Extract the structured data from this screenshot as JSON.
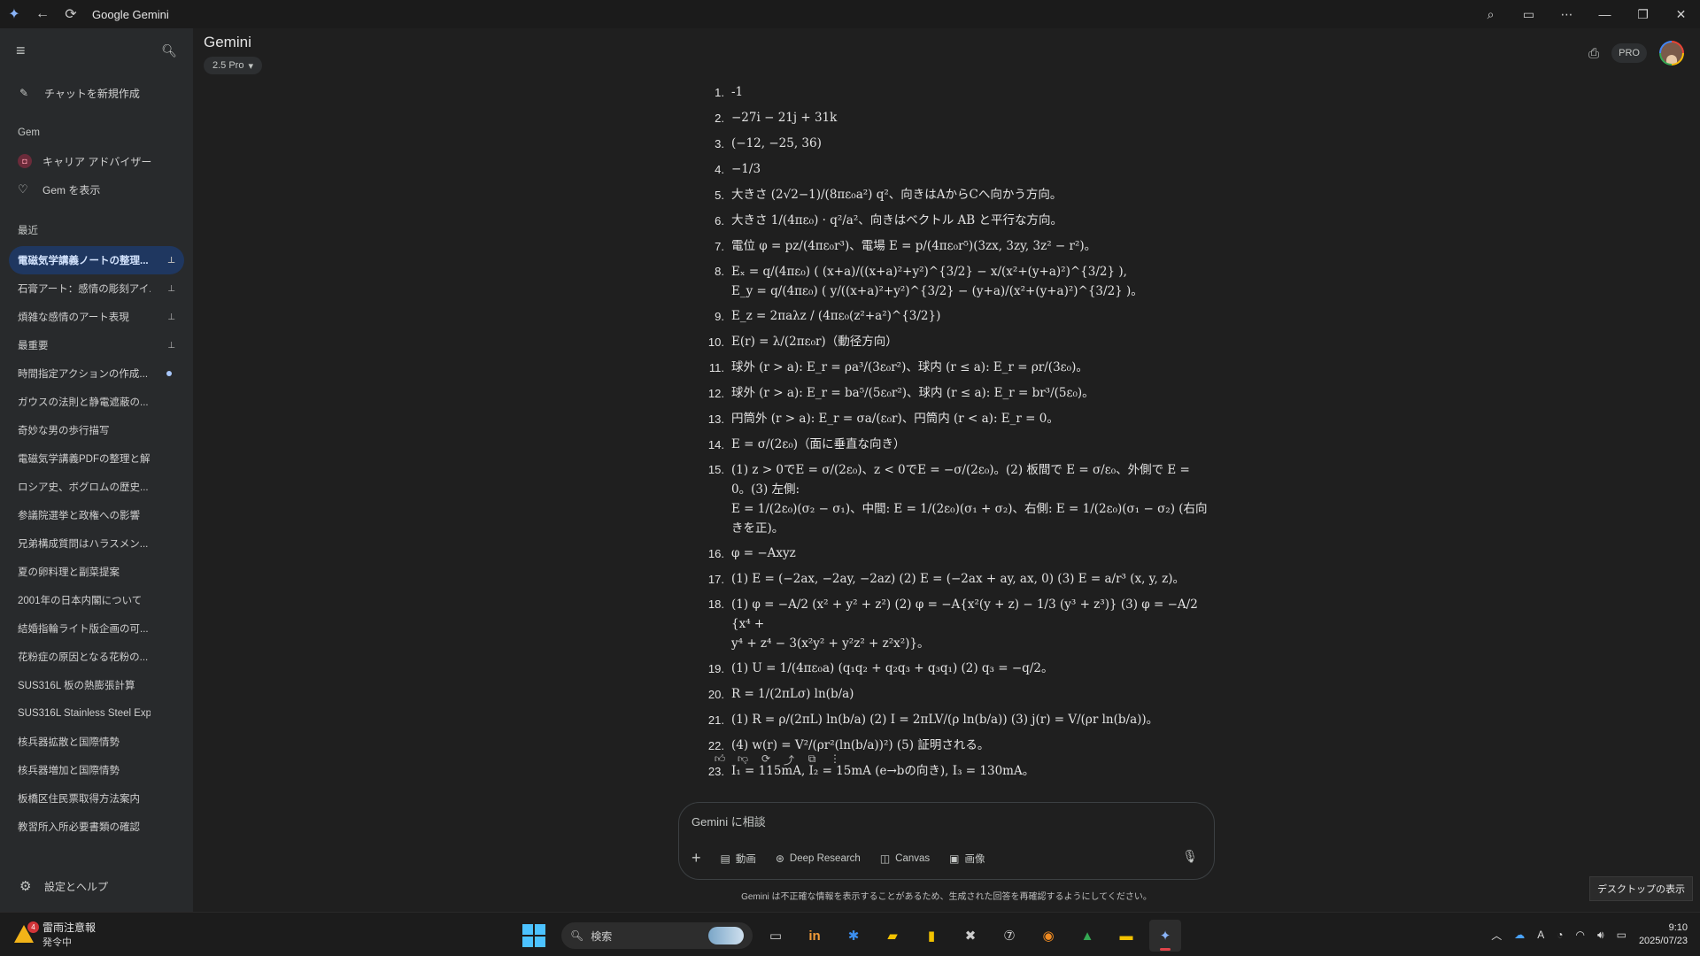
{
  "window": {
    "title": "Google Gemini"
  },
  "sidebar": {
    "new_chat": "チャットを新規作成",
    "gem_section": "Gem",
    "gems": [
      {
        "label": "キャリア アドバイザー",
        "badge": "◘"
      },
      {
        "label": "Gem を表示"
      }
    ],
    "recent_section": "最近",
    "recent": [
      {
        "label": "電磁気学講義ノートの整理...",
        "state": "pin",
        "active": true
      },
      {
        "label": "石膏アート：感情の彫刻アイ...",
        "state": "pin"
      },
      {
        "label": "煩雑な感情のアート表現",
        "state": "pin"
      },
      {
        "label": "最重要",
        "state": "pin"
      },
      {
        "label": "時間指定アクションの作成...",
        "state": "dot"
      },
      {
        "label": "ガウスの法則と静電遮蔽の..."
      },
      {
        "label": "奇妙な男の歩行描写"
      },
      {
        "label": "電磁気学講義PDFの整理と解..."
      },
      {
        "label": "ロシア史、ボグロムの歴史..."
      },
      {
        "label": "参議院選挙と政権への影響"
      },
      {
        "label": "兄弟構成質問はハラスメン..."
      },
      {
        "label": "夏の卵料理と副菜提案"
      },
      {
        "label": "2001年の日本内閣について"
      },
      {
        "label": "結婚指輪ライト版企画の可..."
      },
      {
        "label": "花粉症の原因となる花粉の..."
      },
      {
        "label": "SUS316L 板の熱膨張計算"
      },
      {
        "label": "SUS316L Stainless Steel Expl..."
      },
      {
        "label": "核兵器拡散と国際情勢"
      },
      {
        "label": "核兵器増加と国際情勢"
      },
      {
        "label": "板橋区住民票取得方法案内"
      },
      {
        "label": "教習所入所必要書類の確認"
      }
    ],
    "settings": "設定とヘルプ"
  },
  "header": {
    "title": "Gemini",
    "model": "2.5 Pro",
    "pro_badge": "PRO"
  },
  "answers": [
    {
      "n": "1.",
      "text": "-1"
    },
    {
      "n": "2.",
      "text": "−27i − 21j + 31k"
    },
    {
      "n": "3.",
      "text": "(−12, −25, 36)"
    },
    {
      "n": "4.",
      "text": "−1/3"
    },
    {
      "n": "5.",
      "text": "大きさ (2√2−1)/(8πε₀a²) q²、向きはAからCへ向かう方向。"
    },
    {
      "n": "6.",
      "text": "大きさ 1/(4πε₀) · q²/a²、向きはベクトル AB と平行な方向。"
    },
    {
      "n": "7.",
      "text": "電位 φ = pz/(4πε₀r³)、電場 E = p/(4πε₀r⁵)(3zx, 3zy, 3z² − r²)。"
    },
    {
      "n": "8.",
      "text": "Eₓ = q/(4πε₀) ( (x+a)/((x+a)²+y²)^{3/2} − x/(x²+(y+a)²)^{3/2} ),",
      "text2": "E_y = q/(4πε₀) ( y/((x+a)²+y²)^{3/2} − (y+a)/(x²+(y+a)²)^{3/2} )。"
    },
    {
      "n": "9.",
      "text": "E_z = 2πaλz / (4πε₀(z²+a²)^{3/2})"
    },
    {
      "n": "10.",
      "text": "E(r) = λ/(2πε₀r)（動径方向）"
    },
    {
      "n": "11.",
      "text": "球外 (r > a): E_r = ρa³/(3ε₀r²)、球内 (r ≤ a): E_r = ρr/(3ε₀)。"
    },
    {
      "n": "12.",
      "text": "球外 (r > a): E_r = ba⁵/(5ε₀r²)、球内 (r ≤ a): E_r = br³/(5ε₀)。"
    },
    {
      "n": "13.",
      "text": "円筒外 (r > a): E_r = σa/(ε₀r)、円筒内 (r < a): E_r = 0。"
    },
    {
      "n": "14.",
      "text": "E = σ/(2ε₀)（面に垂直な向き）"
    },
    {
      "n": "15.",
      "text": "(1) z > 0でE = σ/(2ε₀)、z < 0でE = −σ/(2ε₀)。(2) 板間で E = σ/ε₀、外側で E = 0。(3) 左側:",
      "text2": "E = 1/(2ε₀)(σ₂ − σ₁)、中間: E = 1/(2ε₀)(σ₁ + σ₂)、右側: E = 1/(2ε₀)(σ₁ − σ₂) (右向きを正)。"
    },
    {
      "n": "16.",
      "text": "φ = −Axyz"
    },
    {
      "n": "17.",
      "text": "(1) E = (−2ax, −2ay, −2az) (2) E = (−2ax + ay, ax, 0) (3) E = a/r³ (x, y, z)。"
    },
    {
      "n": "18.",
      "text": "(1) φ = −A/2 (x² + y² + z²) (2) φ = −A{x²(y + z) − 1/3 (y³ + z³)} (3) φ = −A/2 {x⁴ +",
      "text2": "y⁴ + z⁴ − 3(x²y² + y²z² + z²x²)}。"
    },
    {
      "n": "19.",
      "text": "(1) U = 1/(4πε₀a) (q₁q₂ + q₂q₃ + q₃q₁) (2) q₃ = −q/2。"
    },
    {
      "n": "20.",
      "text": "R = 1/(2πLσ) ln(b/a)"
    },
    {
      "n": "21.",
      "text": "(1) R = ρ/(2πL) ln(b/a) (2) I = 2πLV/(ρ ln(b/a)) (3) j(r) = V/(ρr ln(b/a))。"
    },
    {
      "n": "22.",
      "text": "(4) w(r) = V²/(ρr²(ln(b/a))²) (5) 証明される。"
    },
    {
      "n": "23.",
      "text": "I₁ = 115mA, I₂ = 15mA (e→bの向き), I₃ = 130mA。"
    }
  ],
  "input": {
    "placeholder": "Gemini に相談",
    "tools": [
      {
        "label": "動画",
        "icon": "video-icon"
      },
      {
        "label": "Deep Research",
        "icon": "research-icon"
      },
      {
        "label": "Canvas",
        "icon": "canvas-icon"
      },
      {
        "label": "画像",
        "icon": "image-icon"
      }
    ]
  },
  "disclaimer": "Gemini は不正確な情報を表示することがあるため、生成された回答を再確認するようにしてください。",
  "desktop_tip": "デスクトップの表示",
  "taskbar": {
    "weather_title": "雷雨注意報",
    "weather_sub": "発令中",
    "weather_badge": "4",
    "search": "検索",
    "time": "9:10",
    "date": "2025/07/23"
  },
  "colors": {
    "accent": "#1f3760",
    "background": "#1f1f1f",
    "sidebar": "#282a2c"
  }
}
